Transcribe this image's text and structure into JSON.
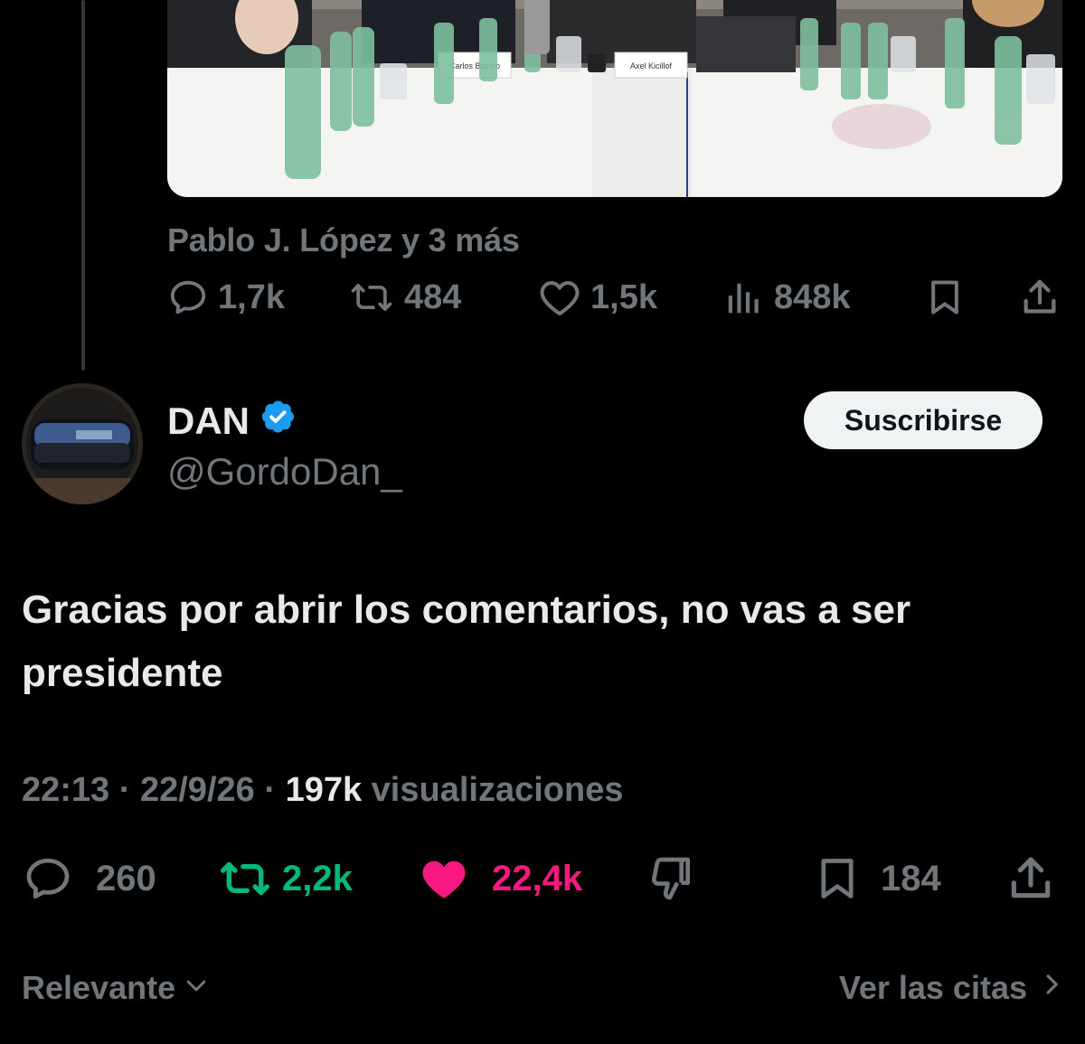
{
  "photo": {
    "name_cards": [
      "Carlos Bianco",
      "Axel Kicillof"
    ]
  },
  "tagged_people": "Pablo J. López y 3 más",
  "quoted_actions": {
    "replies": "1,7k",
    "reposts": "484",
    "likes": "1,5k",
    "views": "848k"
  },
  "author": {
    "name": "DAN",
    "handle": "@GordoDan_",
    "verified": true,
    "verified_color": "#1d9bf0"
  },
  "subscribe_label": "Suscribirse",
  "tweet": {
    "text": "Gracias por abrir los comentarios, no vas a ser presidente",
    "time": "22:13",
    "date": "22/9/26",
    "views_count": "197k",
    "views_label": "visualizaciones"
  },
  "actions": {
    "replies": "260",
    "reposts": "2,2k",
    "likes": "22,4k",
    "bookmarks": "184"
  },
  "colors": {
    "background": "#000000",
    "text": "#e7e9ea",
    "muted": "#71767b",
    "repost_active": "#00ba7c",
    "like_active": "#f91880"
  },
  "footer": {
    "sort_label": "Relevante",
    "quotes_link": "Ver las citas"
  }
}
